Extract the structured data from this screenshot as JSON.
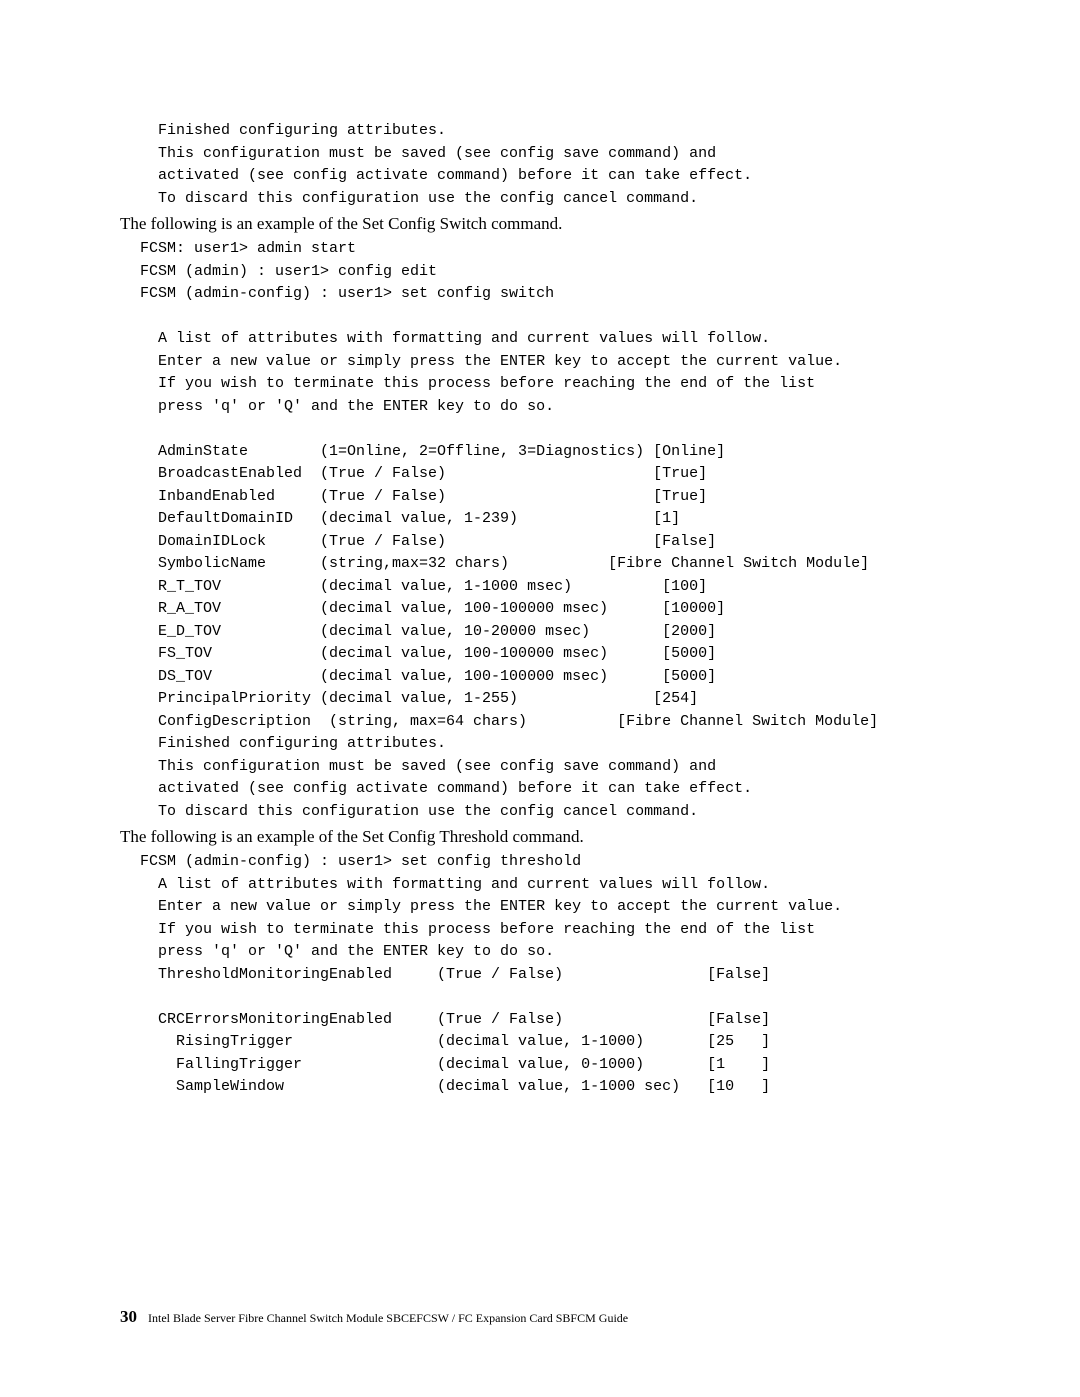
{
  "blocks": [
    {
      "type": "code",
      "text": "  Finished configuring attributes.\n  This configuration must be saved (see config save command) and\n  activated (see config activate command) before it can take effect.\n  To discard this configuration use the config cancel command."
    },
    {
      "type": "body",
      "text": "The following is an example of the Set Config Switch command."
    },
    {
      "type": "code",
      "text": "FCSM: user1> admin start\nFCSM (admin) : user1> config edit\nFCSM (admin-config) : user1> set config switch\n\n  A list of attributes with formatting and current values will follow.\n  Enter a new value or simply press the ENTER key to accept the current value.\n  If you wish to terminate this process before reaching the end of the list\n  press 'q' or 'Q' and the ENTER key to do so.\n\n  AdminState        (1=Online, 2=Offline, 3=Diagnostics) [Online]\n  BroadcastEnabled  (True / False)                       [True]\n  InbandEnabled     (True / False)                       [True]\n  DefaultDomainID   (decimal value, 1-239)               [1]\n  DomainIDLock      (True / False)                       [False]\n  SymbolicName      (string,max=32 chars)           [Fibre Channel Switch Module]\n  R_T_TOV           (decimal value, 1-1000 msec)          [100]\n  R_A_TOV           (decimal value, 100-100000 msec)      [10000]\n  E_D_TOV           (decimal value, 10-20000 msec)        [2000]\n  FS_TOV            (decimal value, 100-100000 msec)      [5000]\n  DS_TOV            (decimal value, 100-100000 msec)      [5000]\n  PrincipalPriority (decimal value, 1-255)               [254]\n  ConfigDescription  (string, max=64 chars)          [Fibre Channel Switch Module]\n  Finished configuring attributes.\n  This configuration must be saved (see config save command) and\n  activated (see config activate command) before it can take effect.\n  To discard this configuration use the config cancel command."
    },
    {
      "type": "body",
      "text": "The following is an example of the Set Config Threshold command."
    },
    {
      "type": "code",
      "text": "FCSM (admin-config) : user1> set config threshold\n  A list of attributes with formatting and current values will follow.\n  Enter a new value or simply press the ENTER key to accept the current value.\n  If you wish to terminate this process before reaching the end of the list\n  press 'q' or 'Q' and the ENTER key to do so.\n  ThresholdMonitoringEnabled     (True / False)                [False]\n\n  CRCErrorsMonitoringEnabled     (True / False)                [False]\n    RisingTrigger                (decimal value, 1-1000)       [25   ]\n    FallingTrigger               (decimal value, 0-1000)       [1    ]\n    SampleWindow                 (decimal value, 1-1000 sec)   [10   ]"
    }
  ],
  "footer": {
    "page_num": "30",
    "text": "Intel Blade Server Fibre Channel Switch Module SBCEFCSW / FC Expansion Card SBFCM Guide"
  }
}
